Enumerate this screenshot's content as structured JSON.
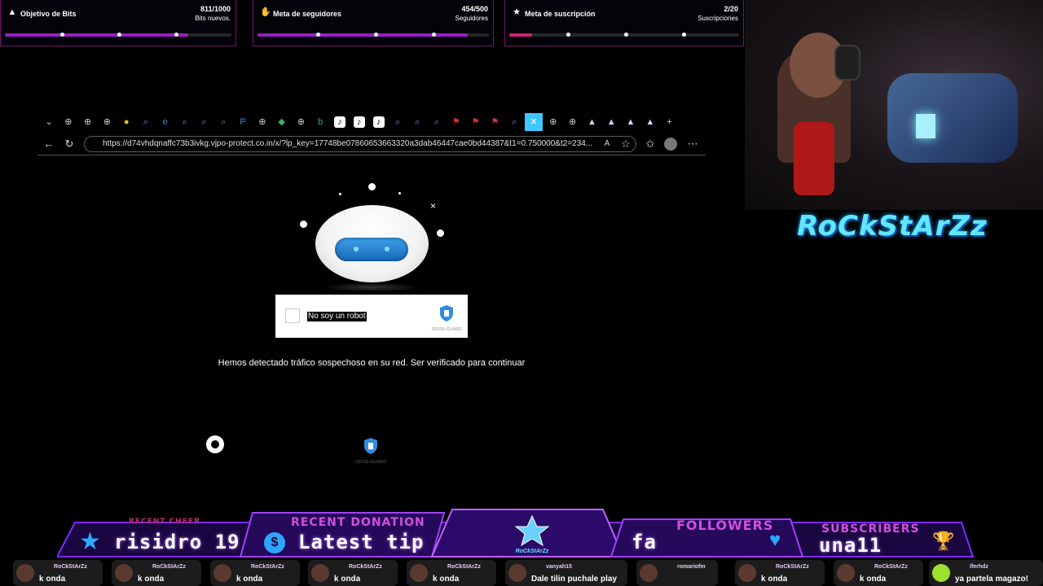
{
  "goals": {
    "bits": {
      "title": "Objetivo de Bits",
      "count": "811/1000",
      "subtitle": "Bits nuevos.",
      "progress": 0.811,
      "color": "#9b1ec8"
    },
    "followers": {
      "title": "Meta de seguidores",
      "count": "454/500",
      "subtitle": "Seguidores",
      "progress": 0.908,
      "color": "#9b1ec8"
    },
    "subs": {
      "title": "Meta de suscripción",
      "count": "2/20",
      "subtitle": "Suscripciones",
      "progress": 0.1,
      "color": "#d81e78"
    }
  },
  "browser": {
    "url": "https://d74vhdqnaffc73b3ivkg.vjpo-protect.co.in/x/?lp_key=17748be07860653663320a3dab46447cae0bd44387&t1=0.750000&t2=234...",
    "tab_icons": [
      "chevron-down-icon",
      "globe-icon",
      "globe-icon",
      "globe-icon",
      "coin-icon",
      "search-icon",
      "edge-icon",
      "search-icon",
      "search-icon",
      "search-icon",
      "p-icon",
      "globe-icon",
      "shield-icon",
      "globe-icon",
      "b-icon",
      "tiktok-icon",
      "tiktok-icon",
      "tiktok-icon",
      "search-icon",
      "search-icon",
      "search-icon",
      "flag-icon",
      "flag-icon",
      "flag-icon",
      "search-icon",
      "close-tab-icon",
      "globe-icon",
      "globe-icon",
      "bell-icon",
      "bell-icon",
      "bell-icon",
      "bell-icon",
      "plus-icon"
    ]
  },
  "captcha": {
    "checkbox_label": "No soy un robot",
    "brand_small": "DDOS-GUARD",
    "message": "Hemos detectado tráfico sospechoso en su red. Ser verificado para continuar",
    "footer_brand": "DDOS-GUARD"
  },
  "webcam": {
    "brand": "RoCkStArZz"
  },
  "overlay": {
    "recent_cheer_head": "RECENT CHEER",
    "recent_cheer_value": "risidro 19",
    "recent_donation_head": "RECENT DONATION",
    "recent_donation_value": "Latest tip",
    "center_logo": "RoCkStArZz",
    "followers_head": "FOLLOWERS",
    "followers_value": "fa",
    "subscribers_head": "SUBSCRIBERS",
    "subscribers_value": "una11"
  },
  "chat": [
    {
      "user": "RoCkStArZz",
      "msg": "k onda"
    },
    {
      "user": "RoCkStArZz",
      "msg": "k onda"
    },
    {
      "user": "RoCkStArZz",
      "msg": "k onda"
    },
    {
      "user": "RoCkStArZz",
      "msg": "k onda"
    },
    {
      "user": "RoCkStArZz",
      "msg": "k onda"
    },
    {
      "user": "vanyah15",
      "msg": "Dale tilin puchale play"
    },
    {
      "user": "romariofm",
      "msg": ""
    },
    {
      "user": "RoCkStArZz",
      "msg": "k onda"
    },
    {
      "user": "RoCkStArZz",
      "msg": "k onda"
    },
    {
      "user": "lferhdz",
      "msg": "ya partela magazo!"
    }
  ]
}
